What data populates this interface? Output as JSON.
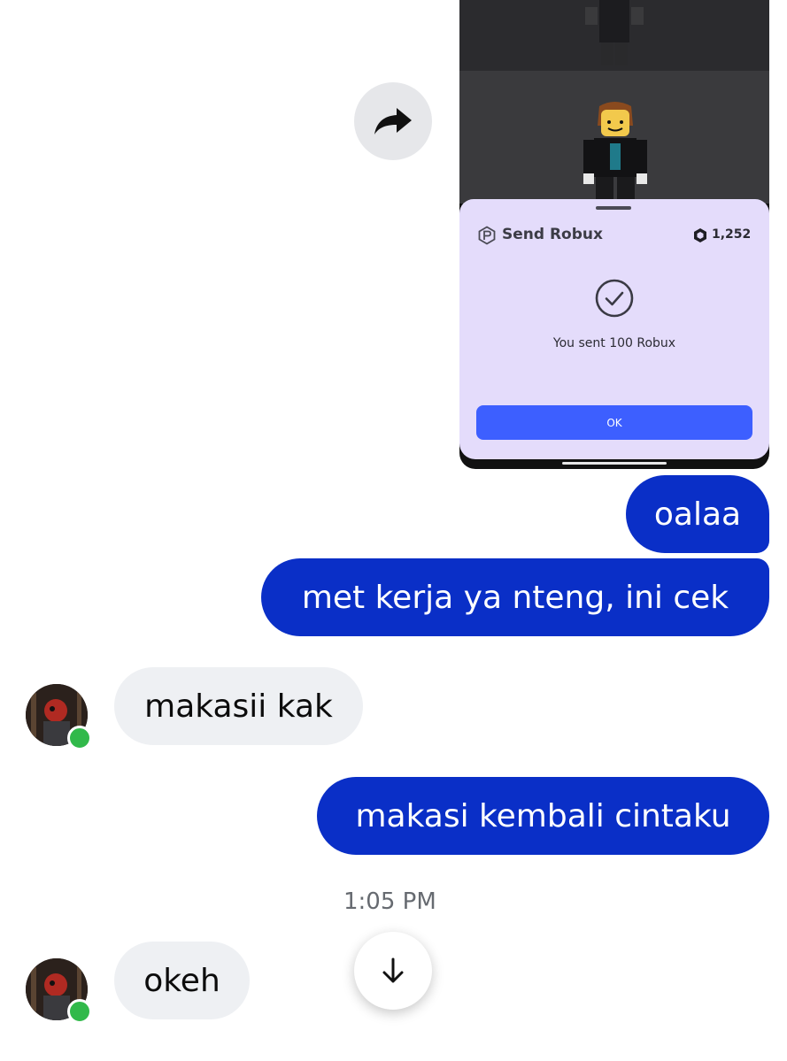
{
  "shared_screenshot": {
    "sheet_title": "Send Robux",
    "balance": "1,252",
    "confirmation": "You sent 100 Robux",
    "ok_label": "OK"
  },
  "messages": [
    {
      "direction": "outgoing",
      "text": "oalaa"
    },
    {
      "direction": "outgoing",
      "text": "met kerja ya nteng, ini cek"
    },
    {
      "direction": "incoming",
      "text": "makasii kak"
    },
    {
      "direction": "outgoing",
      "text": "makasi kembali cintaku"
    },
    {
      "direction": "incoming",
      "text": "okeh"
    }
  ],
  "timestamp": "1:05 PM",
  "icons": {
    "forward": "forward-icon",
    "scroll_down": "arrow-down-icon",
    "check": "check-circle-icon",
    "robux": "robux-icon"
  },
  "colors": {
    "outgoing_bubble": "#0a2fc7",
    "incoming_bubble": "#eef0f3",
    "online": "#31b94a",
    "ok_button": "#3d5fff"
  }
}
